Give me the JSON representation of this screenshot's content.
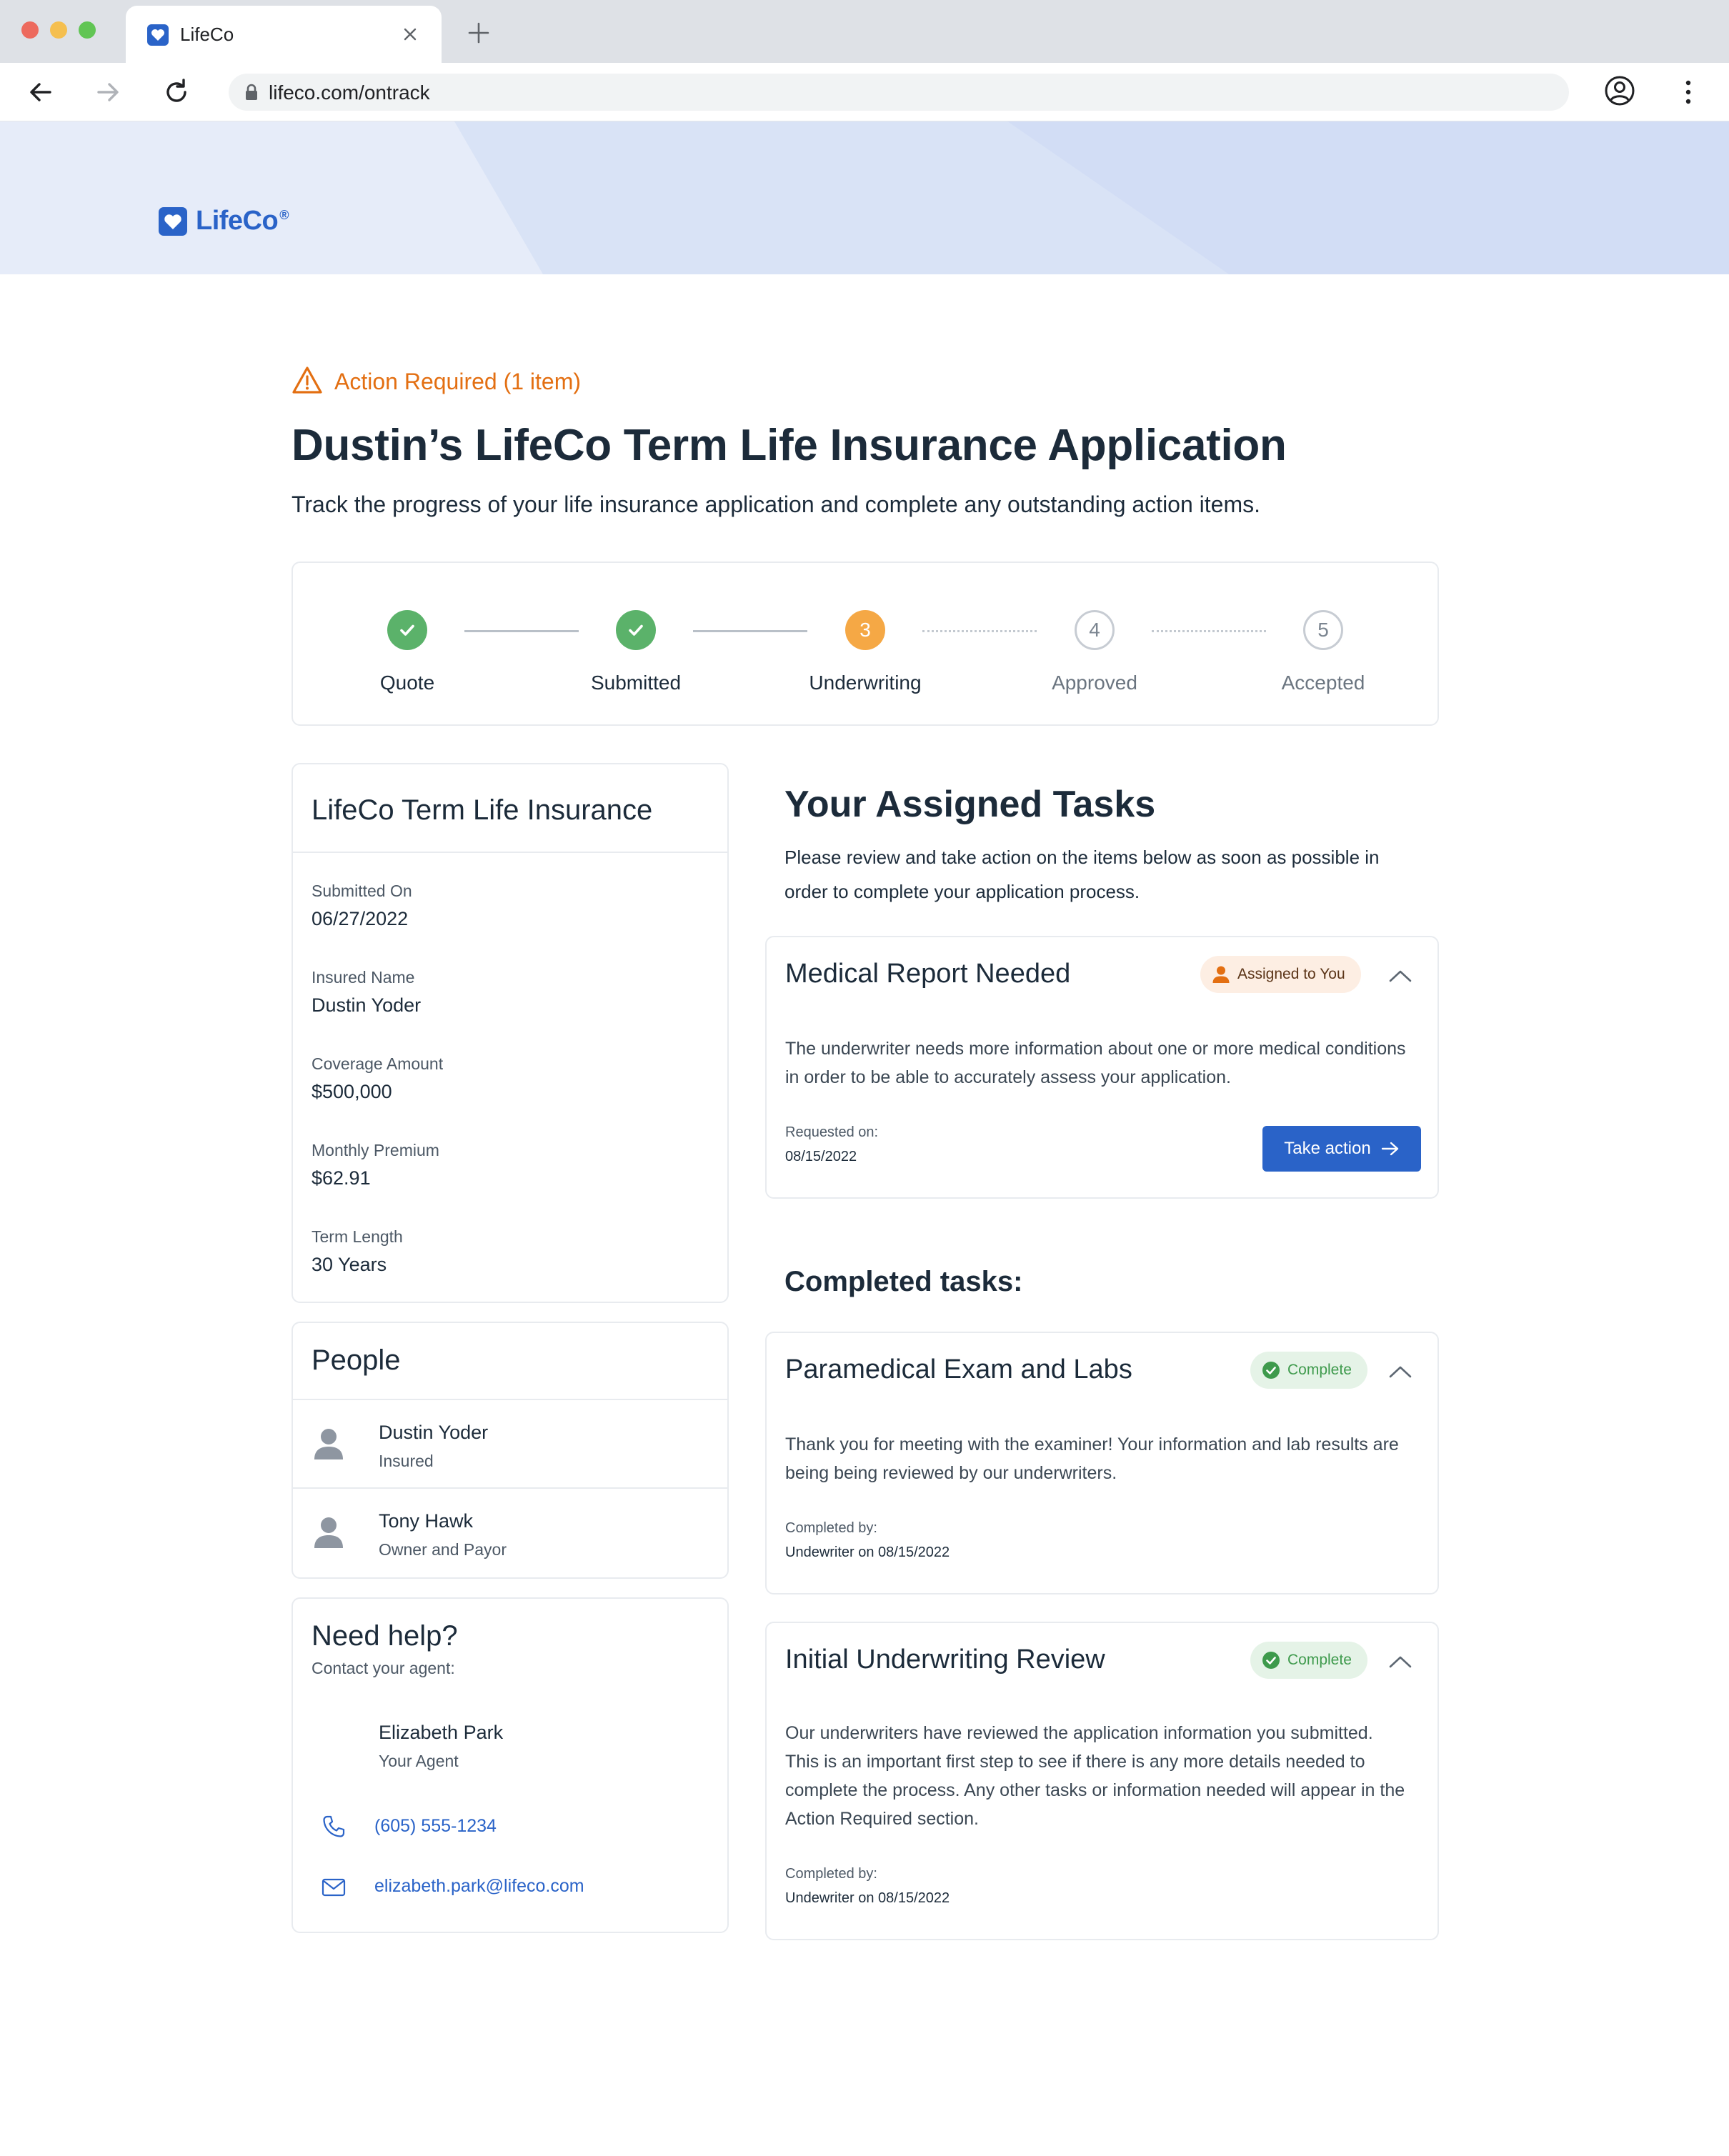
{
  "browser": {
    "tab_title": "LifeCo",
    "url": "lifeco.com/ontrack"
  },
  "brand": {
    "name": "LifeCo",
    "reg": "®",
    "color": "#2a63c8"
  },
  "alert": {
    "text": "Action Required (1 item)",
    "color": "#e36f12"
  },
  "page": {
    "title": "Dustin’s LifeCo Term Life Insurance Application",
    "subtitle": "Track the progress of your life insurance application and complete any outstanding action items."
  },
  "stepper": {
    "steps": [
      {
        "number": "1",
        "label": "Quote",
        "state": "done"
      },
      {
        "number": "2",
        "label": "Submitted",
        "state": "done"
      },
      {
        "number": "3",
        "label": "Underwriting",
        "state": "current"
      },
      {
        "number": "4",
        "label": "Approved",
        "state": "todo"
      },
      {
        "number": "5",
        "label": "Accepted",
        "state": "todo"
      }
    ]
  },
  "policy": {
    "title": "LifeCo Term Life Insurance",
    "fields": [
      {
        "label": "Submitted On",
        "value": "06/27/2022"
      },
      {
        "label": "Insured Name",
        "value": "Dustin Yoder"
      },
      {
        "label": "Coverage Amount",
        "value": "$500,000"
      },
      {
        "label": "Monthly Premium",
        "value": "$62.91"
      },
      {
        "label": "Term Length",
        "value": "30 Years"
      }
    ]
  },
  "people": {
    "title": "People",
    "items": [
      {
        "name": "Dustin Yoder",
        "role": "Insured"
      },
      {
        "name": "Tony Hawk",
        "role": "Owner and Payor"
      }
    ]
  },
  "help": {
    "title": "Need help?",
    "subtitle": "Contact your agent:",
    "agent_name": "Elizabeth Park",
    "agent_role": "Your Agent",
    "phone": "(605) 555-1234",
    "email": "elizabeth.park@lifeco.com"
  },
  "tasks": {
    "title": "Your Assigned Tasks",
    "description": "Please review and take action on the items below as soon as possible in order to complete your application process.",
    "assigned": [
      {
        "title": "Medical Report Needed",
        "badge": "Assigned to You",
        "body": "The underwriter needs more information about one or more medical conditions in order to be able to accurately assess your application.",
        "meta_label": "Requested on:",
        "meta_value": "08/15/2022",
        "action_label": "Take action"
      }
    ],
    "completed_title": "Completed tasks:",
    "completed": [
      {
        "title": "Paramedical Exam and Labs",
        "badge": "Complete",
        "body": "Thank you for meeting with the examiner!  Your information and lab results are being being reviewed by our underwriters.",
        "meta_label": "Completed by:",
        "meta_value": "Undewriter on 08/15/2022"
      },
      {
        "title": "Initial Underwriting Review",
        "badge": "Complete",
        "body": "Our underwriters have reviewed the application information you submitted.  This is an important first step to see if there is any more details needed to complete the process.  Any other tasks or information needed will appear in the Action Required section.",
        "meta_label": "Completed by:",
        "meta_value": "Undewriter on 08/15/2022"
      }
    ]
  }
}
